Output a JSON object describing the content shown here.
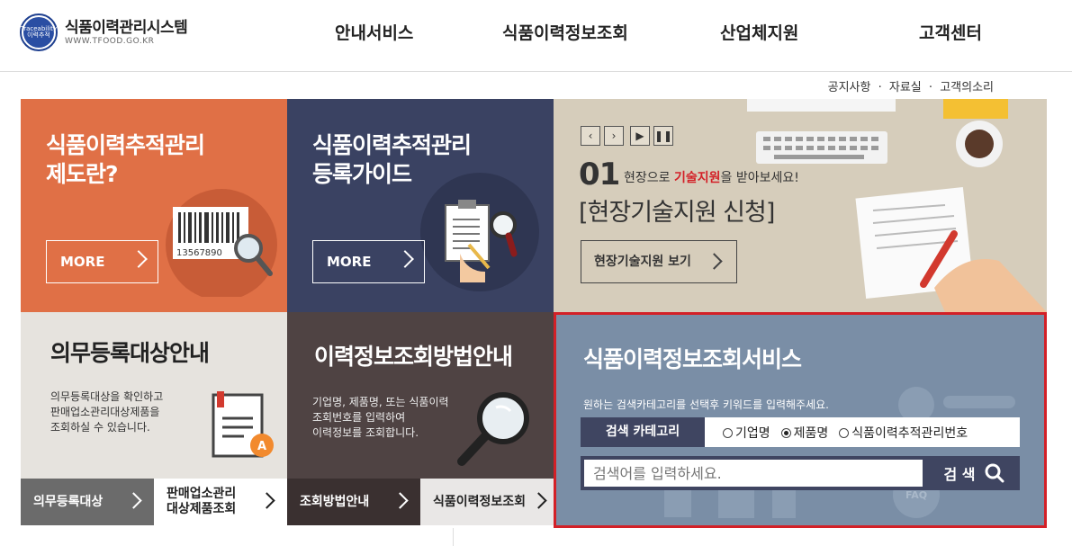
{
  "header": {
    "logo_badge": "Traceability 이력추적",
    "site_title": "식품이력관리시스템",
    "site_url": "WWW.TFOOD.GO.KR",
    "nav": [
      "안내서비스",
      "식품이력정보조회",
      "산업체지원",
      "고객센터"
    ]
  },
  "util_links": [
    "공지사항",
    "자료실",
    "고객의소리"
  ],
  "util_separator": "·",
  "tiles": {
    "system_intro": {
      "title_line1": "식품이력추적관리",
      "title_line2": "제도란?",
      "more": "MORE",
      "barcode_number": "13567890"
    },
    "register_guide": {
      "title_line1": "식품이력추적관리",
      "title_line2": "등록가이드",
      "more": "MORE"
    },
    "tech_support": {
      "number": "01",
      "subtitle_pre": "현장으로 ",
      "subtitle_highlight": "기술지원",
      "subtitle_post": "을 받아보세요!",
      "headline": "[현장기술지원 신청]",
      "button": "현장기술지원 보기"
    },
    "mandatory": {
      "title": "의무등록대상안내",
      "desc_line1": "의무등록대상을 확인하고",
      "desc_line2": "판매업소관리대상제품을",
      "desc_line3": "조회하실 수 있습니다.",
      "btn_left": "의무등록대상",
      "btn_right_line1": "판매업소관리",
      "btn_right_line2": "대상제품조회"
    },
    "lookup_method": {
      "title": "이력정보조회방법안내",
      "desc_line1": "기업명, 제품명, 또는 식품이력",
      "desc_line2": "조회번호를 입력하여",
      "desc_line3": "이력정보를 조회합니다.",
      "btn_left": "조회방법안내",
      "btn_right": "식품이력정보조회"
    },
    "search_service": {
      "title": "식품이력정보조회서비스",
      "desc": "원하는 검색카테고리를 선택후 키워드를 입력해주세요.",
      "category_label": "검색 카테고리",
      "options": [
        "기업명",
        "제품명",
        "식품이력추적관리번호"
      ],
      "selected_option": "제품명",
      "placeholder": "검색어를 입력하세요.",
      "search_button": "검 색",
      "faq_icon_text": "FAQ"
    }
  },
  "colors": {
    "orange": "#e07046",
    "navy": "#3a4262",
    "beige": "#d6cdbb",
    "search_bg": "#7a8ea6",
    "highlight_red": "#d32027",
    "dark_button": "#3f4561"
  }
}
